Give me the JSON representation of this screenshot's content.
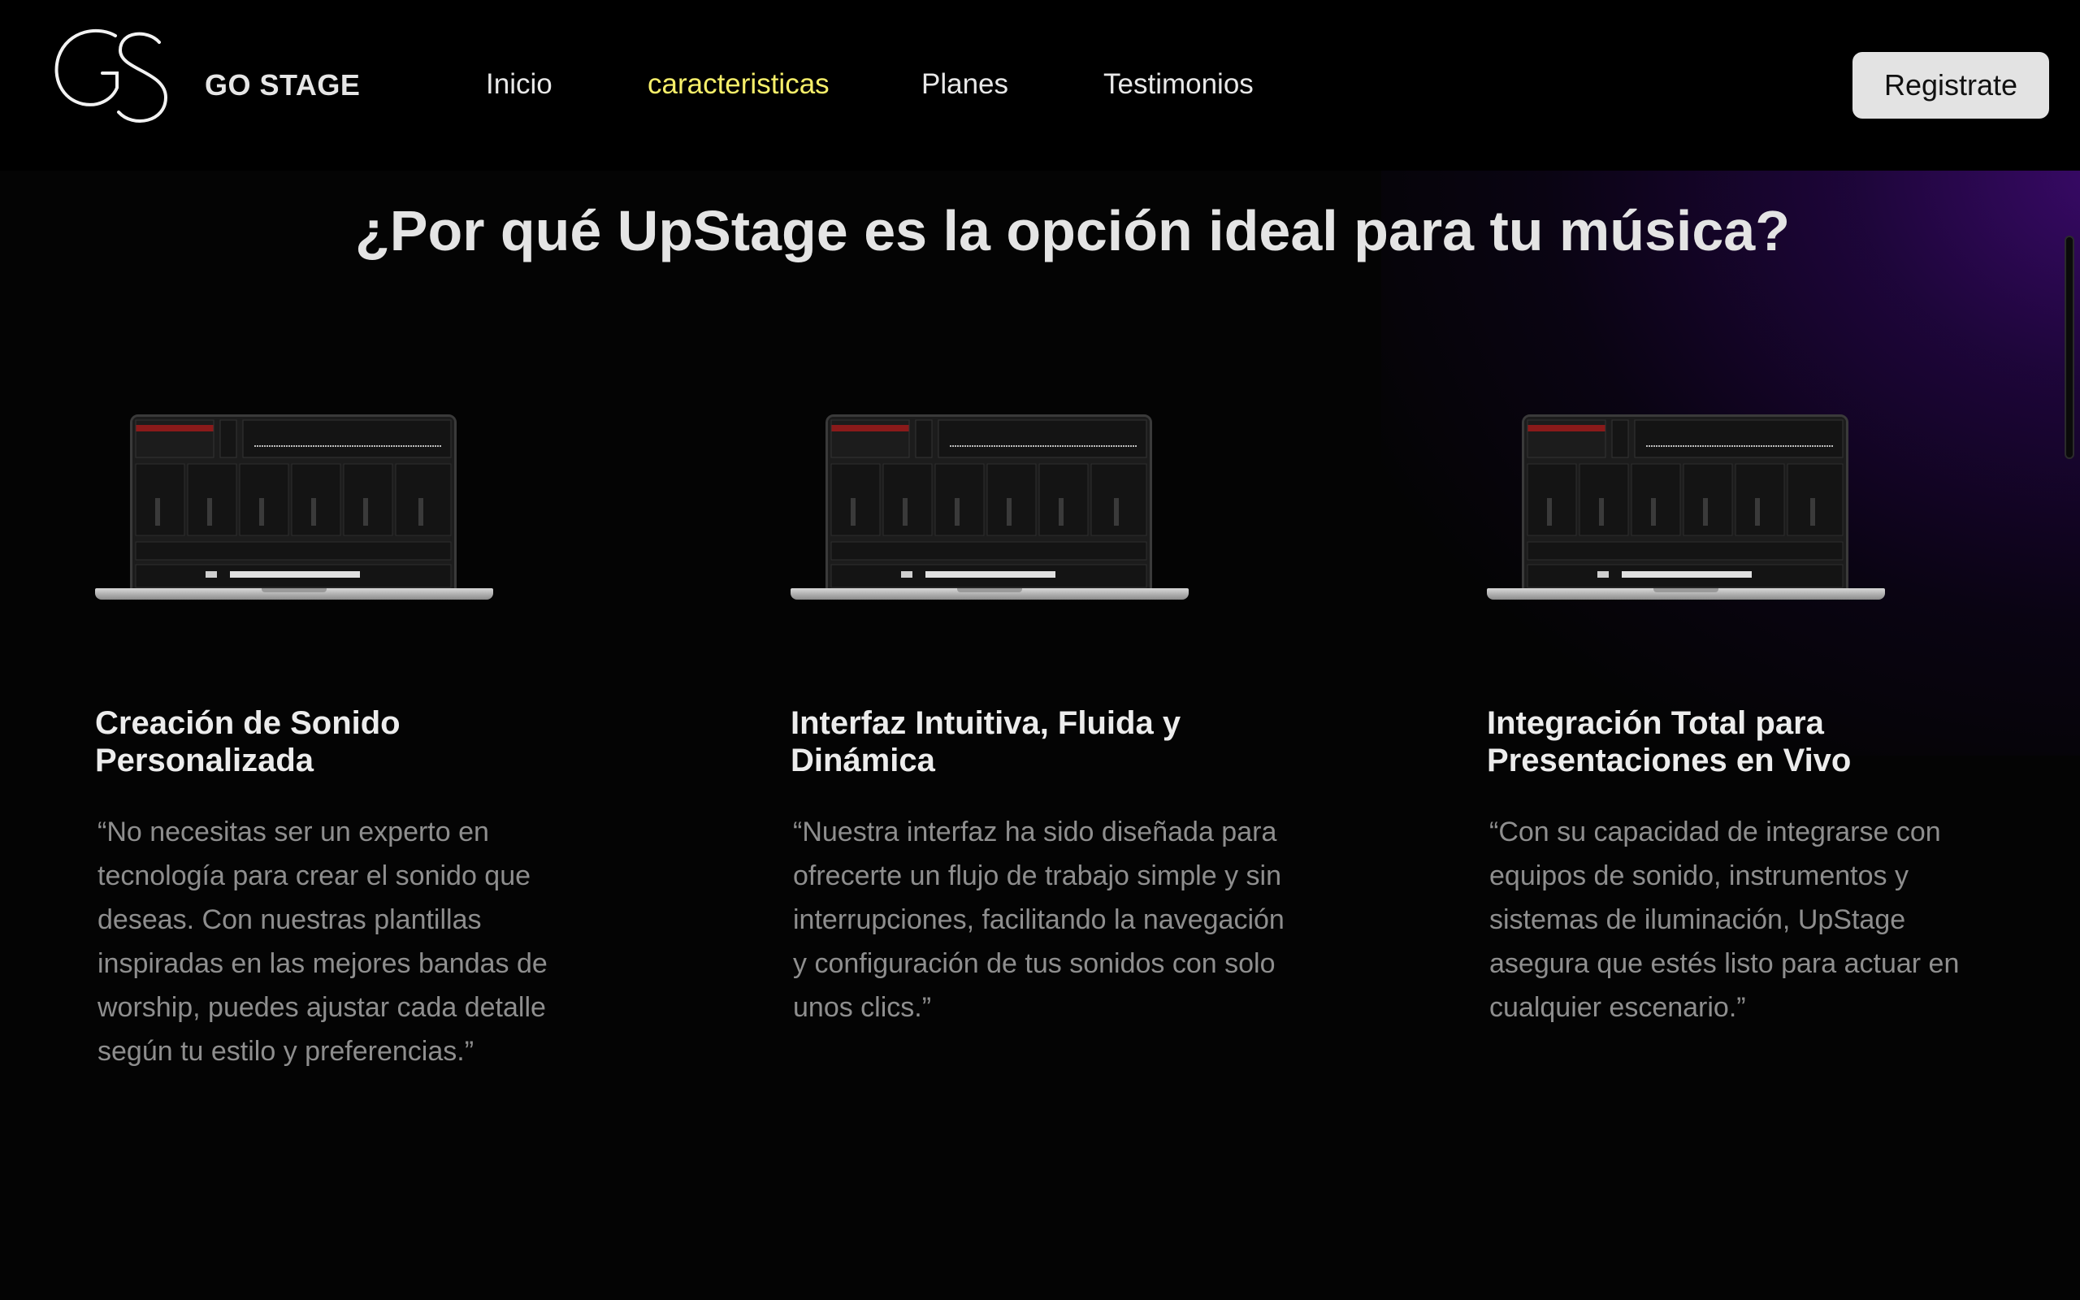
{
  "header": {
    "brand": "GO STAGE",
    "logo_text": "GS",
    "nav": [
      {
        "label": "Inicio",
        "active": false
      },
      {
        "label": "caracteristicas",
        "active": true
      },
      {
        "label": "Planes",
        "active": false
      },
      {
        "label": "Testimonios",
        "active": false
      }
    ],
    "cta_label": "Registrate"
  },
  "main": {
    "title": "¿Por qué UpStage es la opción ideal para tu música?",
    "features": [
      {
        "title": "Creación de Sonido Personalizada",
        "text": "“No necesitas ser un experto en tecnología para crear el sonido que deseas. Con nuestras plantillas inspiradas en las mejores bandas de worship, puedes ajustar cada detalle según tu estilo y preferencias.”"
      },
      {
        "title": "Interfaz Intuitiva, Fluida y Dinámica",
        "text": "“Nuestra interfaz ha sido diseñada para ofrecerte un flujo de trabajo simple y sin interrupciones, facilitando la navegación y configuración de tus sonidos con solo unos clics.”"
      },
      {
        "title": "Integración Total para Presentaciones en Vivo",
        "text": "“Con su capacidad de integrarse con equipos de sonido, instrumentos y sistemas de iluminación, UpStage asegura que estés listo para actuar en cualquier escenario.”"
      }
    ]
  },
  "colors": {
    "background": "#040404",
    "active_nav": "#f7ef6a",
    "accent_glow": "#3c0a6e",
    "cta_bg": "#e3e3e3",
    "body_text": "#8e8e8e"
  }
}
